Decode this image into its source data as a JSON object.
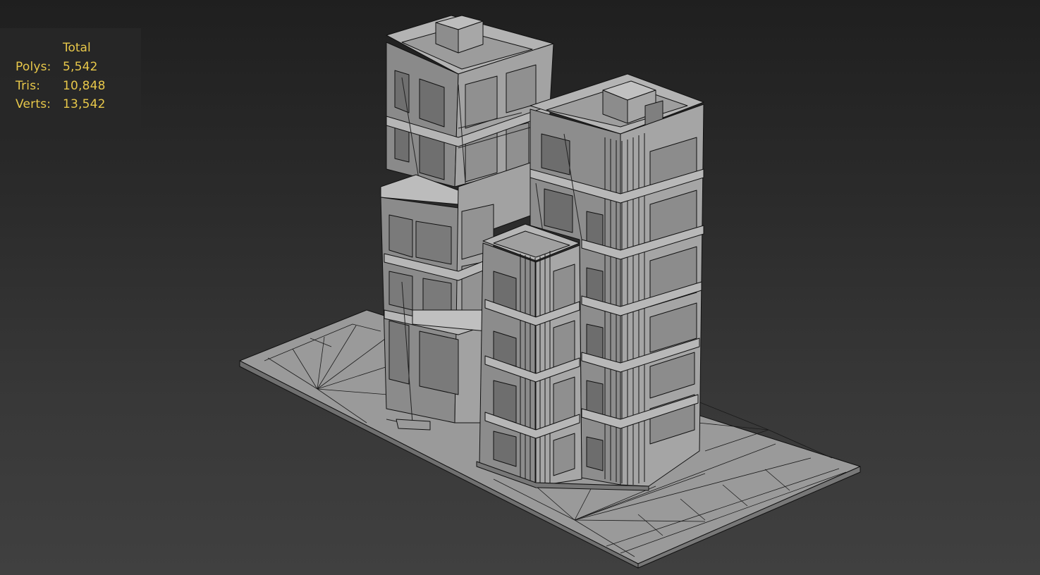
{
  "viewport": {
    "stats": {
      "header": "Total",
      "rows": [
        {
          "label": "Polys:",
          "value": "5,542"
        },
        {
          "label": "Tris:",
          "value": "10,848"
        },
        {
          "label": "Verts:",
          "value": "13,542"
        }
      ]
    },
    "colors": {
      "stats_text": "#e8c84a",
      "mesh_light": "#a9a9a9",
      "mesh_mid": "#8f8f8f",
      "mesh_dark": "#6e6e6e",
      "wire": "#111111"
    },
    "mesh": "building-wireframe"
  }
}
